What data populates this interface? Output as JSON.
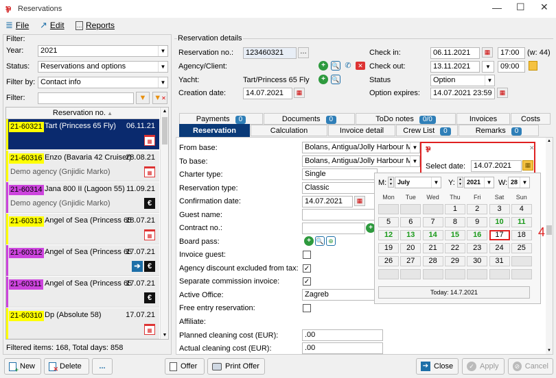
{
  "window": {
    "title": "Reservations"
  },
  "menu": {
    "file": "File",
    "edit": "Edit",
    "reports": "Reports"
  },
  "filter": {
    "group": "Filter:",
    "year_label": "Year:",
    "year_value": "2021",
    "status_label": "Status:",
    "status_value": "Reservations and options",
    "filterby_label": "Filter by:",
    "filterby_value": "Contact info",
    "filter_label": "Filter:",
    "filter_value": "",
    "list_header": "Reservation no.",
    "summary": "Filtered items: 168,  Total days: 858"
  },
  "list": [
    {
      "no": "21-60321",
      "name": "Tart (Princess 65 Fly)",
      "date": "06.11.21",
      "sub": "",
      "tag_color": "#ffff00",
      "bar_color": "#ffff00",
      "selected": true,
      "icons": [
        "calendar-icon"
      ]
    },
    {
      "no": "21-60316",
      "name": "Enzo (Bavaria 42 Cruiser)",
      "date": "28.08.21",
      "sub": "Demo agency (Gnjidic Marko)",
      "tag_color": "#ffff00",
      "bar_color": "#ffff00",
      "selected": false,
      "icons": [
        "calendar-icon"
      ]
    },
    {
      "no": "21-60314",
      "name": "Jana 800 II (Lagoon 55)",
      "date": "11.09.21",
      "sub": "Demo agency (Gnjidic Marko)",
      "tag_color": "#cc44dd",
      "bar_color": "#cc44dd",
      "selected": false,
      "icons": [
        "euro-icon"
      ]
    },
    {
      "no": "21-60313",
      "name": "Angel of Sea (Princess 65",
      "date": "18.07.21",
      "sub": "",
      "tag_color": "#ffff00",
      "bar_color": "#ffff00",
      "selected": false,
      "icons": [
        "calendar-icon"
      ]
    },
    {
      "no": "21-60312",
      "name": "Angel of Sea (Princess 65",
      "date": "17.07.21",
      "sub": "",
      "tag_color": "#cc44dd",
      "bar_color": "#cc44dd",
      "selected": false,
      "icons": [
        "arrow-icon",
        "euro-icon"
      ]
    },
    {
      "no": "21-60311",
      "name": "Angel of Sea (Princess 65",
      "date": "17.07.21",
      "sub": "",
      "tag_color": "#cc44dd",
      "bar_color": "#cc44dd",
      "selected": false,
      "icons": [
        "euro-icon"
      ]
    },
    {
      "no": "21-60310",
      "name": "Dp (Absolute 58)",
      "date": "17.07.21",
      "sub": "",
      "tag_color": "#ffff00",
      "bar_color": "#ffff00",
      "selected": false,
      "icons": [
        "calendar-icon"
      ]
    }
  ],
  "details": {
    "group": "Reservation details",
    "resno_label": "Reservation no.:",
    "resno_value": "123460321",
    "agency_label": "Agency/Client:",
    "yacht_label": "Yacht:",
    "yacht_value": "Tart/Princess 65 Fly",
    "creation_label": "Creation date:",
    "creation_value": "14.07.2021",
    "checkin_label": "Check in:",
    "checkin_date": "06.11.2021",
    "checkin_time": "17:00",
    "checkin_week": "(w: 44)",
    "checkout_label": "Check out:",
    "checkout_date": "13.11.2021",
    "checkout_time": "09:00",
    "status_label": "Status",
    "status_value": "Option",
    "optexp_label": "Option expires:",
    "optexp_value": "14.07.2021 23:59"
  },
  "tabs_top": [
    {
      "label": "Payments",
      "badge": "0"
    },
    {
      "label": "Documents",
      "badge": "0"
    },
    {
      "label": "ToDo notes",
      "badge": "0/0"
    },
    {
      "label": "Invoices",
      "badge": ""
    },
    {
      "label": "Costs",
      "badge": ""
    }
  ],
  "tabs_bottom": [
    {
      "label": "Reservation",
      "badge": ""
    },
    {
      "label": "Calculation",
      "badge": ""
    },
    {
      "label": "Invoice detail",
      "badge": ""
    },
    {
      "label": "Crew List",
      "badge": "0"
    },
    {
      "label": "Remarks",
      "badge": "0"
    }
  ],
  "form": {
    "from_base_label": "From base:",
    "from_base_value": "Bolans, Antigua/Jolly Harbour M...",
    "to_base_label": "To base:",
    "to_base_value": "Bolans, Antigua/Jolly Harbour M...",
    "charter_label": "Charter type:",
    "charter_value": "Single",
    "restype_label": "Reservation type:",
    "restype_value": "Classic",
    "confdate_label": "Confirmation date:",
    "confdate_value": "14.07.2021",
    "guest_label": "Guest name:",
    "contract_label": "Contract no.:",
    "boardpass_label": "Board pass:",
    "invguest_label": "Invoice guest:",
    "agdisc_label": "Agency discount excluded from tax:",
    "sepcomm_label": "Separate commission invoice:",
    "office_label": "Active Office:",
    "office_value": "Zagreb",
    "freeentry_label": "Free entry reservation:",
    "affiliate_label": "Affiliate:",
    "plannedclean_label": "Planned cleaning cost (EUR):",
    "plannedclean_value": ".00",
    "actualclean_label": "Actual cleaning cost (EUR):",
    "actualclean_value": ".00"
  },
  "datepicker": {
    "select_label": "Select date:",
    "select_value": "14.07.2021",
    "m_label": "M:",
    "month": "July",
    "y_label": "Y:",
    "year": "2021",
    "w_label": "W:",
    "week": "28",
    "weekdays": [
      "Mon",
      "Tue",
      "Wed",
      "Thu",
      "Fri",
      "Sat",
      "Sun"
    ],
    "days": [
      [
        "",
        "",
        "",
        "1",
        "2",
        "3",
        "4"
      ],
      [
        "5",
        "6",
        "7",
        "8",
        "9",
        "10",
        "11"
      ],
      [
        "12",
        "13",
        "14",
        "15",
        "16",
        "17",
        "18"
      ],
      [
        "19",
        "20",
        "21",
        "22",
        "23",
        "24",
        "25"
      ],
      [
        "26",
        "27",
        "28",
        "29",
        "30",
        "31",
        ""
      ],
      [
        "",
        "",
        "",
        "",
        "",
        "",
        ""
      ]
    ],
    "today": "Today: 14.7.2021",
    "annotation": "4"
  },
  "buttons": {
    "new": "New",
    "delete": "Delete",
    "more": "...",
    "offer": "Offer",
    "print_offer": "Print Offer",
    "close": "Close",
    "apply": "Apply",
    "cancel": "Cancel"
  },
  "colors": {
    "selected_row": "#0a2a6e",
    "accent": "#1d6fa8",
    "highlight_red": "#e02020",
    "green_day": "#1a9a1a"
  }
}
